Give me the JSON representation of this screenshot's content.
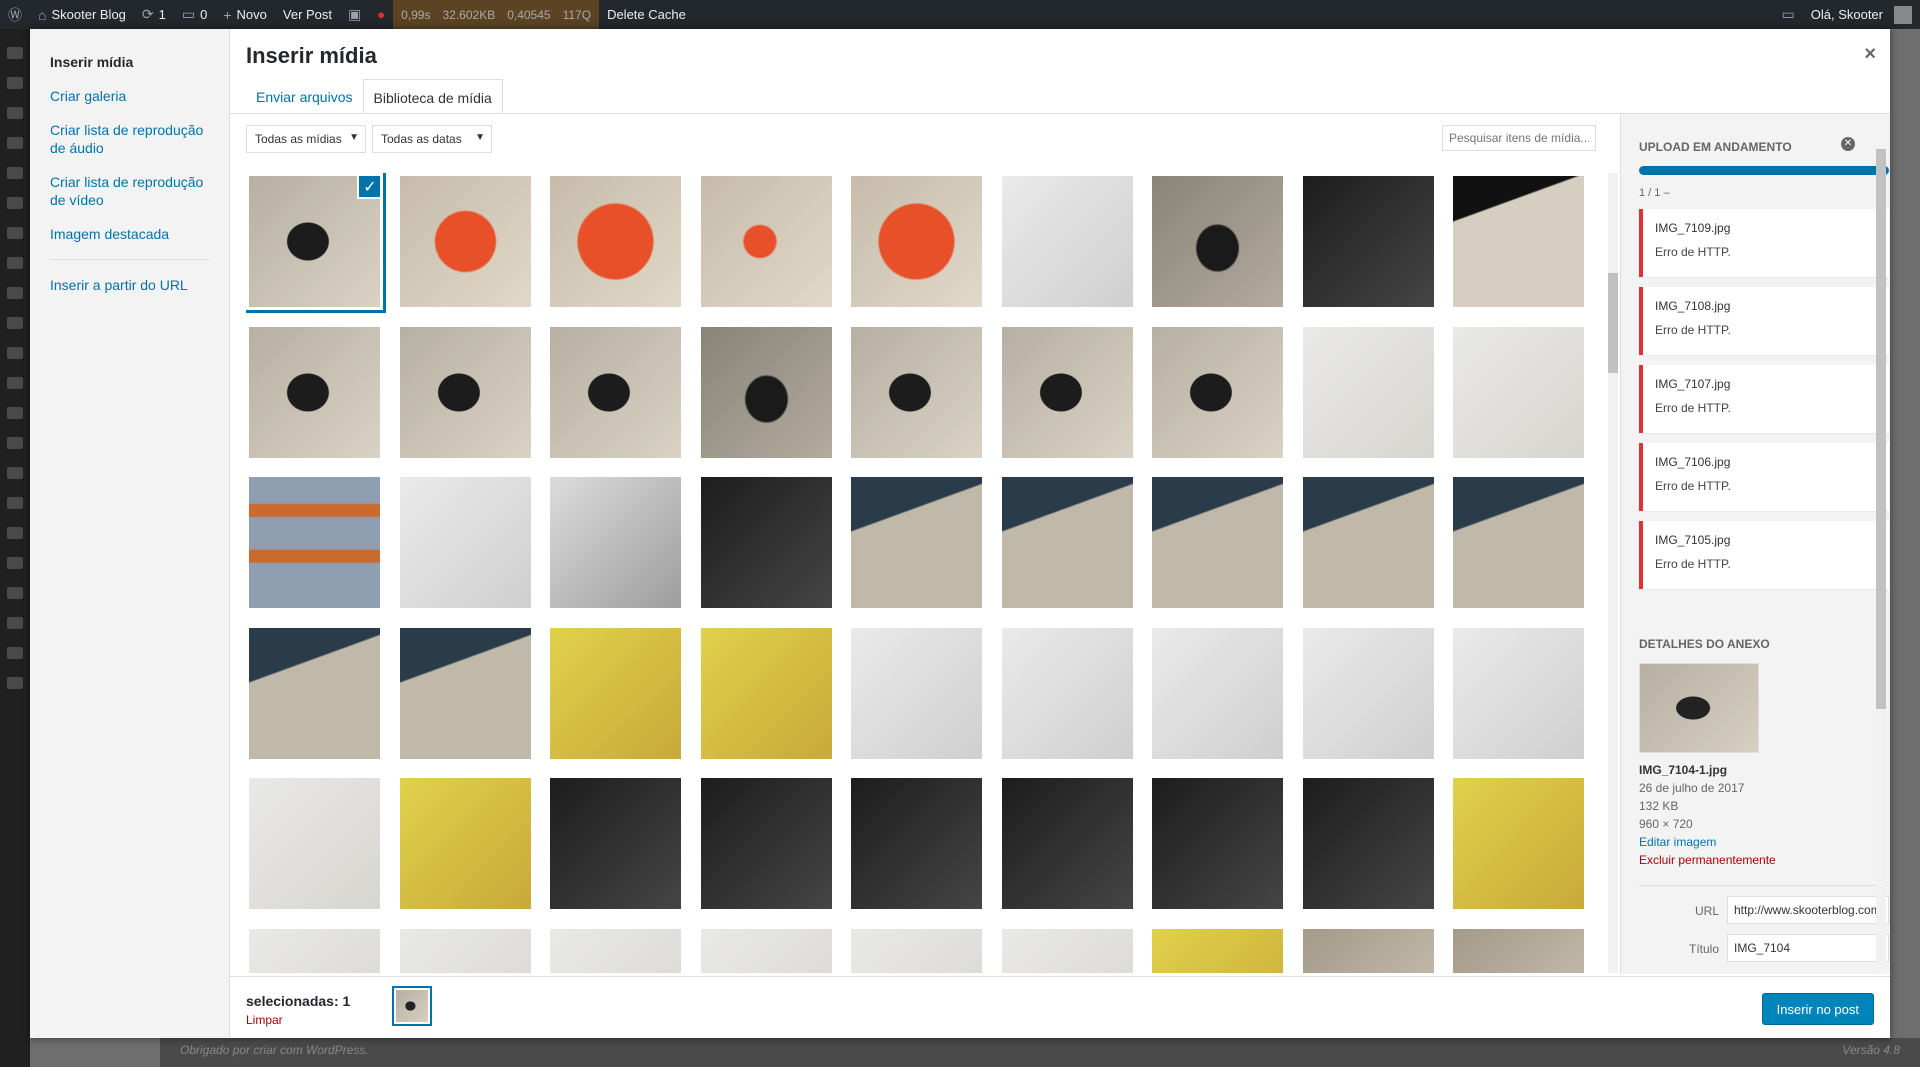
{
  "adminbar": {
    "site_name": "Skooter Blog",
    "updates": "1",
    "comments": "0",
    "new_label": "Novo",
    "view_post": "Ver Post",
    "perf": [
      "0,99s",
      "32.602KB",
      "0,40545",
      "117Q"
    ],
    "delete_cache": "Delete Cache",
    "greeting": "Olá, Skooter"
  },
  "footer": {
    "thanks": "Obrigado por criar com WordPress.",
    "version": "Versão 4.8"
  },
  "menu": {
    "items": [
      {
        "label": "Inserir mídia",
        "active": true
      },
      {
        "label": "Criar galeria"
      },
      {
        "label": "Criar lista de reprodução de áudio"
      },
      {
        "label": "Criar lista de reprodução de vídeo"
      },
      {
        "label": "Imagem destacada"
      },
      {
        "label": "Inserir a partir do URL"
      }
    ]
  },
  "header": {
    "title": "Inserir mídia",
    "close": "×"
  },
  "tabs": [
    {
      "label": "Enviar arquivos"
    },
    {
      "label": "Biblioteca de mídia",
      "active": true
    }
  ],
  "filters": {
    "type": "Todas as mídias",
    "date": "Todas as datas",
    "search_placeholder": "Pesquisar itens de mídia..."
  },
  "uploads": {
    "heading": "Upload em andamento",
    "count": "1 / 1  –",
    "items": [
      {
        "file": "IMG_7109.jpg",
        "error": "Erro de HTTP."
      },
      {
        "file": "IMG_7108.jpg",
        "error": "Erro de HTTP."
      },
      {
        "file": "IMG_7107.jpg",
        "error": "Erro de HTTP."
      },
      {
        "file": "IMG_7106.jpg",
        "error": "Erro de HTTP."
      },
      {
        "file": "IMG_7105.jpg",
        "error": "Erro de HTTP."
      }
    ]
  },
  "details": {
    "heading": "Detalhes do anexo",
    "filename": "IMG_7104-1.jpg",
    "date": "26 de julho de 2017",
    "size": "132 KB",
    "dimensions": "960 × 720",
    "edit": "Editar imagem",
    "delete": "Excluir permanentemente",
    "url_label": "URL",
    "url_value": "http://www.skooterblog.com",
    "title_label": "Título",
    "title_value": "IMG_7104"
  },
  "bottom": {
    "selected": "selecionadas: 1",
    "clear": "Limpar",
    "insert": "Inserir no post"
  },
  "colors": {
    "accent": "#0073aa",
    "error": "#dc3232",
    "button": "#0085ba"
  }
}
